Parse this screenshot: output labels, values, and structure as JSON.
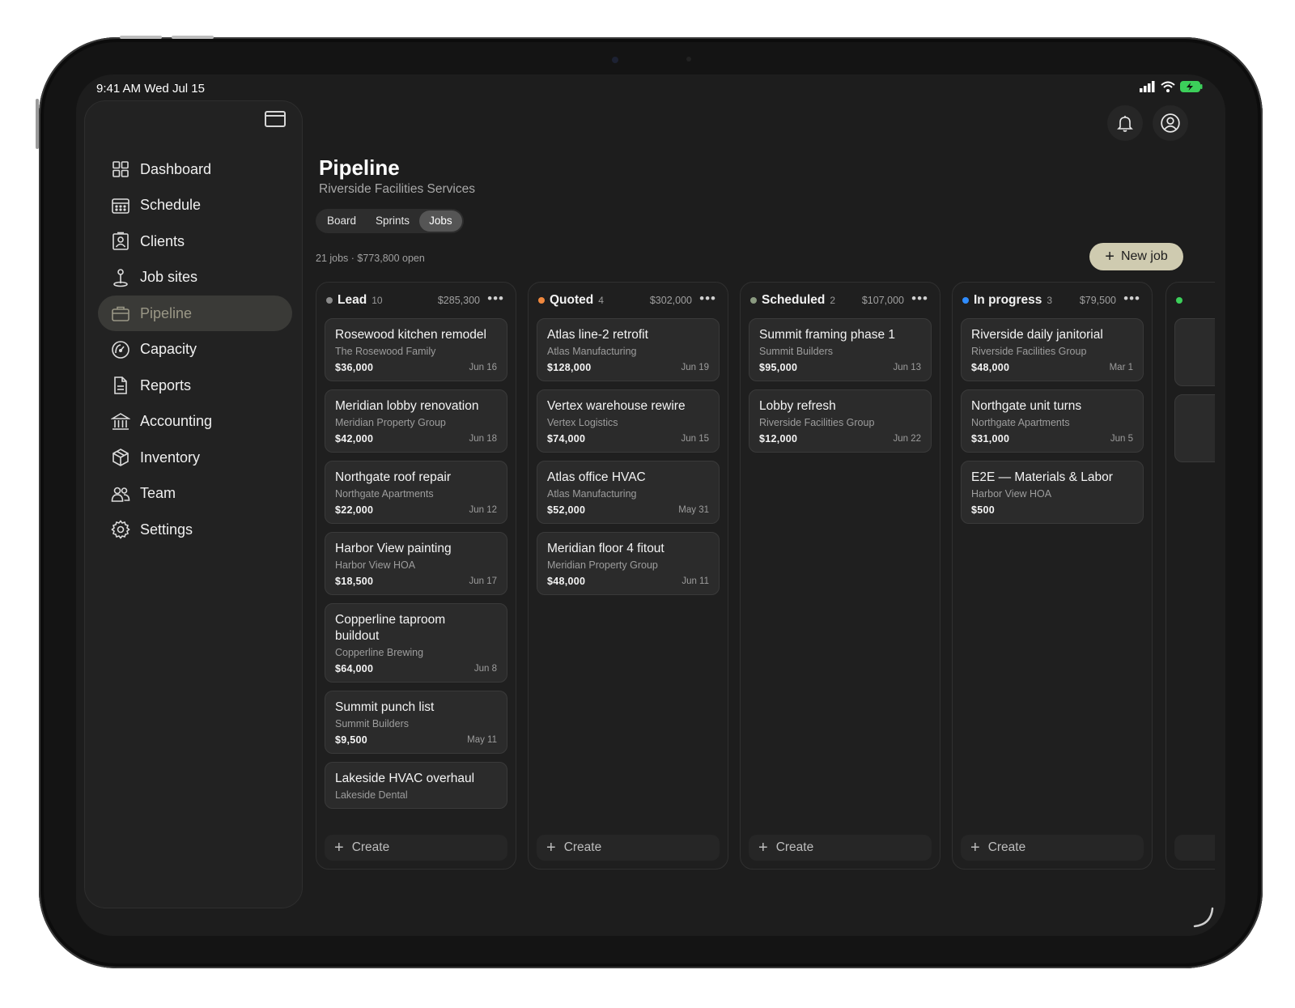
{
  "status_bar": {
    "time": "9:41 AM   Wed Jul 15"
  },
  "colors": {
    "accent": "#cfcbb0",
    "lead": "#8a8a8a",
    "quoted": "#f0883e",
    "scheduled": "#8a9a80",
    "in_progress": "#2f8cff",
    "next": "#3ccf5a"
  },
  "sidebar": {
    "items": [
      {
        "label": "Dashboard",
        "icon": "dashboard-icon"
      },
      {
        "label": "Schedule",
        "icon": "calendar-icon"
      },
      {
        "label": "Clients",
        "icon": "contact-icon"
      },
      {
        "label": "Job sites",
        "icon": "pin-icon"
      },
      {
        "label": "Pipeline",
        "icon": "briefcase-icon",
        "active": true
      },
      {
        "label": "Capacity",
        "icon": "gauge-icon"
      },
      {
        "label": "Reports",
        "icon": "document-icon"
      },
      {
        "label": "Accounting",
        "icon": "bank-icon"
      },
      {
        "label": "Inventory",
        "icon": "box-icon"
      },
      {
        "label": "Team",
        "icon": "team-icon"
      },
      {
        "label": "Settings",
        "icon": "gear-icon"
      }
    ]
  },
  "header": {
    "title": "Pipeline",
    "subtitle": "Riverside Facilities Services",
    "tabs": [
      "Board",
      "Sprints",
      "Jobs"
    ],
    "active_tab": "Jobs",
    "meta": "21 jobs  ·  $773,800 open",
    "new_job_label": "New job"
  },
  "columns": [
    {
      "name": "Lead",
      "count": "10",
      "total": "$285,300",
      "dot": "#8a8a8a",
      "cards": [
        {
          "title": "Rosewood kitchen remodel",
          "client": "The Rosewood Family",
          "amount": "$36,000",
          "date": "Jun 16"
        },
        {
          "title": "Meridian lobby renovation",
          "client": "Meridian Property Group",
          "amount": "$42,000",
          "date": "Jun 18"
        },
        {
          "title": "Northgate roof repair",
          "client": "Northgate Apartments",
          "amount": "$22,000",
          "date": "Jun 12"
        },
        {
          "title": "Harbor View painting",
          "client": "Harbor View HOA",
          "amount": "$18,500",
          "date": "Jun 17"
        },
        {
          "title": "Copperline taproom buildout",
          "client": "Copperline Brewing",
          "amount": "$64,000",
          "date": "Jun 8"
        },
        {
          "title": "Summit punch list",
          "client": "Summit Builders",
          "amount": "$9,500",
          "date": "May 11"
        },
        {
          "title": "Lakeside HVAC overhaul",
          "client": "Lakeside Dental",
          "amount": "",
          "date": ""
        }
      ]
    },
    {
      "name": "Quoted",
      "count": "4",
      "total": "$302,000",
      "dot": "#f0883e",
      "cards": [
        {
          "title": "Atlas line-2 retrofit",
          "client": "Atlas Manufacturing",
          "amount": "$128,000",
          "date": "Jun 19"
        },
        {
          "title": "Vertex warehouse rewire",
          "client": "Vertex Logistics",
          "amount": "$74,000",
          "date": "Jun 15"
        },
        {
          "title": "Atlas office HVAC",
          "client": "Atlas Manufacturing",
          "amount": "$52,000",
          "date": "May 31"
        },
        {
          "title": "Meridian floor 4 fitout",
          "client": "Meridian Property Group",
          "amount": "$48,000",
          "date": "Jun 11"
        }
      ]
    },
    {
      "name": "Scheduled",
      "count": "2",
      "total": "$107,000",
      "dot": "#8a9a80",
      "cards": [
        {
          "title": "Summit framing phase 1",
          "client": "Summit Builders",
          "amount": "$95,000",
          "date": "Jun 13"
        },
        {
          "title": "Lobby refresh",
          "client": "Riverside Facilities Group",
          "amount": "$12,000",
          "date": "Jun 22"
        }
      ]
    },
    {
      "name": "In progress",
      "count": "3",
      "total": "$79,500",
      "dot": "#2f8cff",
      "cards": [
        {
          "title": "Riverside daily janitorial",
          "client": "Riverside Facilities Group",
          "amount": "$48,000",
          "date": "Mar 1"
        },
        {
          "title": "Northgate unit turns",
          "client": "Northgate Apartments",
          "amount": "$31,000",
          "date": "Jun 5"
        },
        {
          "title": "E2E — Materials & Labor",
          "client": "Harbor View HOA",
          "amount": "$500",
          "date": ""
        }
      ]
    }
  ],
  "create_label": "Create"
}
